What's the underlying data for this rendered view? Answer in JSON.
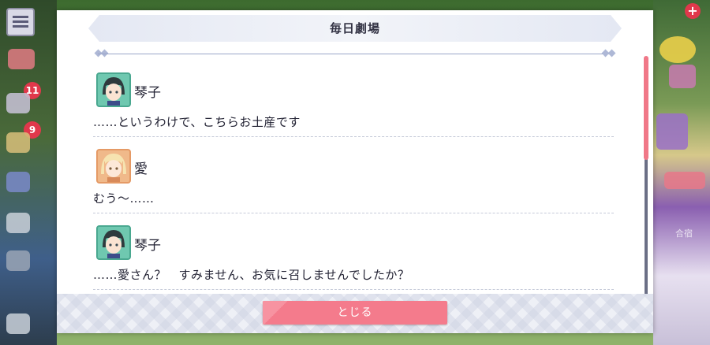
{
  "background": {
    "left_badges": [
      "11",
      "9"
    ],
    "right_label": "合宿"
  },
  "dialog": {
    "title": "毎日劇場",
    "entries": [
      {
        "speaker": "琴子",
        "avatar": "kotoko-avatar",
        "line": "……というわけで、こちらお土産です"
      },
      {
        "speaker": "愛",
        "avatar": "ai-avatar",
        "line": "むう〜……"
      },
      {
        "speaker": "琴子",
        "avatar": "kotoko-avatar",
        "line": "……愛さん？　すみません、お気に召しませんでしたか？"
      }
    ],
    "close_label": "とじる"
  },
  "colors": {
    "accent": "#f47b8c",
    "scroll_thumb": "#f07888",
    "banner": "#e4e8f3"
  }
}
